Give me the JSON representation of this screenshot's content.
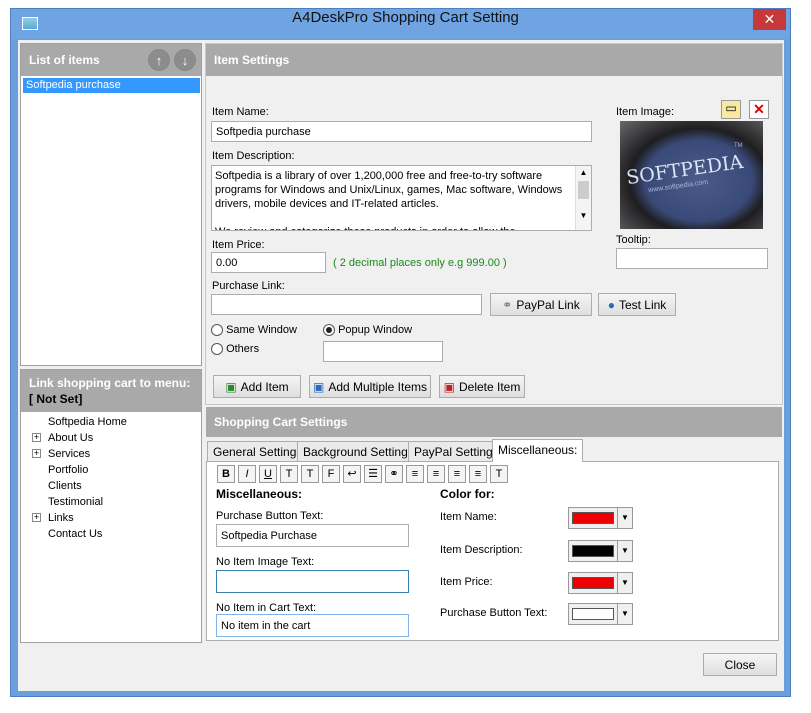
{
  "window": {
    "title": "A4DeskPro Shopping Cart Setting",
    "close": "✕"
  },
  "list": {
    "header": "List of items",
    "items": [
      "Softpedia purchase"
    ]
  },
  "link": {
    "header": "Link shopping cart to menu:",
    "value": "[ Not Set]",
    "tree": [
      {
        "label": "Softpedia Home",
        "expander": ""
      },
      {
        "label": "About Us",
        "expander": "+"
      },
      {
        "label": "Services",
        "expander": "+"
      },
      {
        "label": "Portfolio",
        "expander": ""
      },
      {
        "label": "Clients",
        "expander": ""
      },
      {
        "label": "Testimonial",
        "expander": ""
      },
      {
        "label": "Links",
        "expander": "+"
      },
      {
        "label": "Contact Us",
        "expander": ""
      }
    ]
  },
  "item": {
    "header": "Item Settings",
    "name_label": "Item Name:",
    "name": "Softpedia purchase",
    "desc_label": "Item Description:",
    "desc": "Softpedia is a library of over 1,200,000 free and free-to-try software programs for Windows and Unix/Linux, games, Mac software, Windows drivers, mobile devices and IT-related articles.\n\nWe review and categorize these products in order to allow the",
    "price_label": "Item Price:",
    "price": "0.00",
    "price_hint": "( 2 decimal places only e.g 999.00 )",
    "link_label": "Purchase Link:",
    "link": "",
    "paypal_btn": "PayPal Link",
    "test_btn": "Test Link",
    "radio_same": "Same Window",
    "radio_popup": "Popup Window",
    "radio_others": "Others",
    "others_value": "",
    "image_label": "Item Image:",
    "image_text": "SOFTPEDIA",
    "image_sub": "www.softpedia.com",
    "image_tm": "TM",
    "tooltip_label": "Tooltip:",
    "tooltip": "",
    "add_btn": "Add Item",
    "add_multi_btn": "Add Multiple Items",
    "delete_btn": "Delete Item"
  },
  "cart": {
    "header": "Shopping Cart Settings",
    "tabs": [
      "General Settings",
      "Background Settings",
      "PayPal Settings",
      "Miscellaneous:"
    ],
    "format_buttons": [
      "B",
      "I",
      "U",
      "T",
      "T",
      "F",
      "↩",
      "☰",
      "⚭",
      "≡",
      "≡",
      "≡",
      "≡",
      "T"
    ],
    "misc_title": "Miscellaneous:",
    "purchase_btn_label": "Purchase Button Text:",
    "purchase_btn_text": "Softpedia Purchase",
    "no_image_label": "No Item Image Text:",
    "no_image_text": "",
    "no_cart_label": "No Item in Cart Text:",
    "no_cart_text": "No item in the cart",
    "color_title": "Color for:",
    "colors": [
      {
        "label": "Item Name:",
        "color": "#ee0000"
      },
      {
        "label": "Item Description:",
        "color": "#000000"
      },
      {
        "label": "Item Price:",
        "color": "#ee0000"
      },
      {
        "label": "Purchase Button Text:",
        "color": "#ffffff"
      }
    ]
  },
  "footer": {
    "close": "Close"
  }
}
